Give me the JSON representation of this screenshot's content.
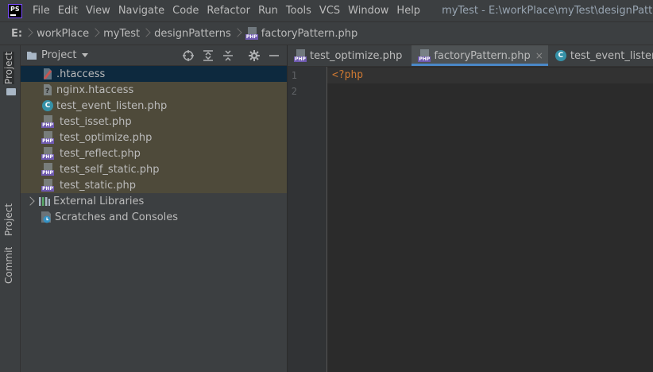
{
  "app": {
    "logo": "PS",
    "window_title": "myTest - E:\\workPlace\\myTest\\designPatterns\\factoryPattern.php"
  },
  "menu": [
    "File",
    "Edit",
    "View",
    "Navigate",
    "Code",
    "Refactor",
    "Run",
    "Tools",
    "VCS",
    "Window",
    "Help"
  ],
  "breadcrumb": {
    "drive": "E:",
    "items": [
      "workPlace",
      "myTest",
      "designPatterns"
    ],
    "file": "factoryPattern.php"
  },
  "left_strip": {
    "tabs": [
      "Project",
      "Project",
      "Commit"
    ]
  },
  "project_panel": {
    "title": "Project",
    "files": [
      {
        "name": ".htaccess",
        "icon": "htaccess-icon",
        "selected": true
      },
      {
        "name": "nginx.htaccess",
        "icon": "unknown-file-icon"
      },
      {
        "name": "test_event_listen.php",
        "icon": "class-icon"
      },
      {
        "name": "test_isset.php",
        "icon": "php-file-icon"
      },
      {
        "name": "test_optimize.php",
        "icon": "php-file-icon"
      },
      {
        "name": "test_reflect.php",
        "icon": "php-file-icon"
      },
      {
        "name": "test_self_static.php",
        "icon": "php-file-icon"
      },
      {
        "name": "test_static.php",
        "icon": "php-file-icon"
      }
    ],
    "roots": [
      "External Libraries",
      "Scratches and Consoles"
    ]
  },
  "editor": {
    "tabs": [
      {
        "label": "test_optimize.php",
        "icon": "php-file-icon",
        "active": false,
        "close": ""
      },
      {
        "label": "factoryPattern.php",
        "icon": "php-file-icon",
        "active": true,
        "close": "×"
      },
      {
        "label": "test_event_listen.php",
        "icon": "class-icon",
        "active": false,
        "close": ""
      }
    ],
    "line_numbers": [
      "1",
      "2"
    ],
    "lines": [
      "<?php",
      ""
    ]
  },
  "colors": {
    "accent": "#4a88c7",
    "keyword": "#cc7832",
    "panel": "#3c3f41",
    "editor_bg": "#2b2b2b",
    "excluded_bg": "#4e4a3a",
    "selected_bg": "#0d293e"
  }
}
